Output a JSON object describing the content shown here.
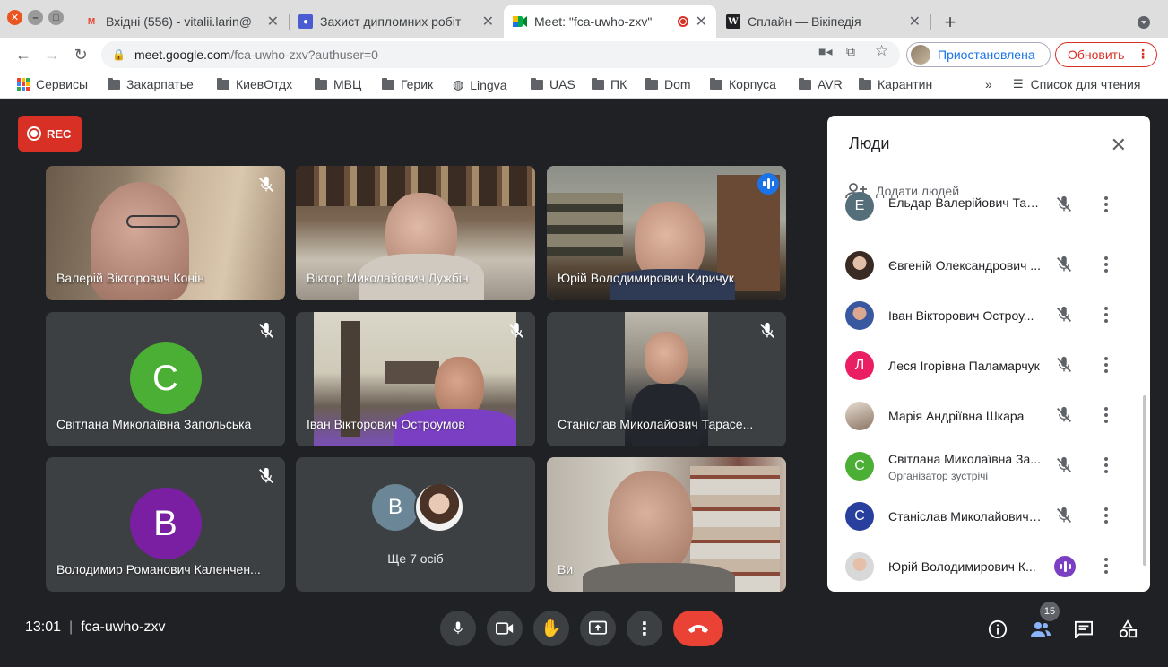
{
  "browser": {
    "tabs": [
      {
        "title": "Вхідні (556) - vitalii.larin@",
        "favicon": "gmail-icon"
      },
      {
        "title": "Захист дипломних робіт",
        "favicon": "classroom-icon"
      },
      {
        "title": "Meet: \"fca-uwho-zxv\"",
        "favicon": "meet-icon",
        "active": true
      },
      {
        "title": "Сплайн — Вікіпедія",
        "favicon": "wikipedia-icon"
      }
    ],
    "url_host": "meet.google.com",
    "url_path": "/fca-uwho-zxv?authuser=0",
    "profile_label": "Приостановлена",
    "update_label": "Обновить"
  },
  "bookmarks": {
    "items": [
      "Сервисы",
      "Закарпатье",
      "КиевОтдх",
      "МВЦ",
      "Герик",
      "Lingva",
      "UAS",
      "ПК",
      "Dom",
      "Корпуса",
      "AVR",
      "Карантин"
    ],
    "overflow": "»",
    "reading_list": "Список для чтения"
  },
  "meet": {
    "rec_label": "REC",
    "tiles": [
      {
        "name": "Валерій Вікторович Конін",
        "muted": true
      },
      {
        "name": "Віктор Миколайович Лужбін",
        "muted": false
      },
      {
        "name": "Юрій Володимирович Киричук",
        "speaking": true
      },
      {
        "name": "Світлана Миколаївна Запольська",
        "muted": true,
        "initial": "С",
        "color": "#4caf35"
      },
      {
        "name": "Іван Вікторович Остроумов",
        "muted": true
      },
      {
        "name": "Станіслав Миколайович Тарасе...",
        "muted": true
      },
      {
        "name": "Володимир Романович Каленчен...",
        "muted": true,
        "initial": "В",
        "color": "#7b1fa2"
      },
      {
        "name": "Ще 7 осіб",
        "initial": "В",
        "color": "#6b8797"
      },
      {
        "name": "Ви"
      }
    ],
    "meeting_time": "13:01",
    "meeting_code": "fca-uwho-zxv",
    "participants_count": "15"
  },
  "people_panel": {
    "title": "Люди",
    "add_people": "Додати людей",
    "people": [
      {
        "name": "Ельдар Валерійович Тар...",
        "initial": "Е",
        "color": "#546e7a",
        "muted": true
      },
      {
        "name": "Євгеній Олександрович ...",
        "initial": "",
        "color": "#4a3a36",
        "muted": true
      },
      {
        "name": "Іван Вікторович Остроу...",
        "initial": "",
        "color": "#3a58a0",
        "muted": true
      },
      {
        "name": "Леся Ігорівна Паламарчук",
        "initial": "Л",
        "color": "#e91e63",
        "muted": true
      },
      {
        "name": "Марія Андріївна Шкара",
        "initial": "",
        "color": "#b8a89a",
        "muted": true
      },
      {
        "name": "Світлана Миколаївна За...",
        "role": "Організатор зустрічі",
        "initial": "С",
        "color": "#4caf35",
        "muted": true
      },
      {
        "name": "Станіслав Миколайович ...",
        "initial": "С",
        "color": "#283f9e",
        "muted": true
      },
      {
        "name": "Юрій Володимирович К...",
        "initial": "",
        "color": "#9e9e9e",
        "speaking": true
      }
    ]
  }
}
